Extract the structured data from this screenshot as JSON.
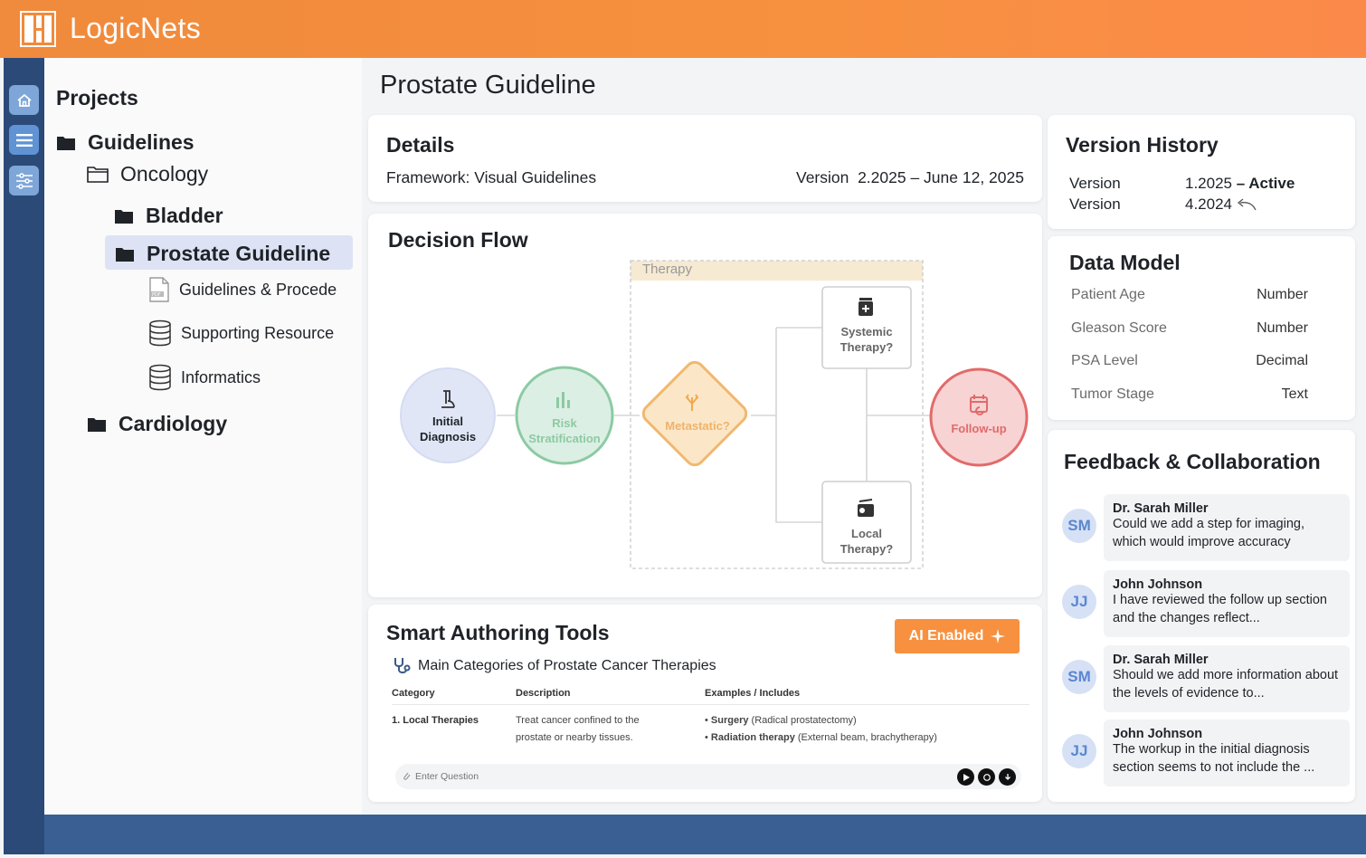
{
  "app": {
    "name": "LogicNets"
  },
  "rail": {
    "icons": [
      "home-icon",
      "menu-icon",
      "sliders-icon"
    ]
  },
  "sidebar": {
    "heading": "Projects",
    "guidelines": "Guidelines",
    "oncology": "Oncology",
    "bladder": "Bladder",
    "prostate": "Prostate Guideline",
    "children": [
      "Guidelines & Procede",
      "Supporting Resource",
      "Informatics"
    ],
    "cardiology": "Cardiology"
  },
  "page": {
    "title": "Prostate Guideline"
  },
  "details": {
    "title": "Details",
    "framework": "Framework: Visual Guidelines",
    "version": "Version  2.2025 – June 12, 2025"
  },
  "version_history": {
    "title": "Version History",
    "rows": [
      {
        "label": "Version",
        "value": "1.2025",
        "status": "– Active"
      },
      {
        "label": "Version",
        "value": "4.2024"
      }
    ]
  },
  "flow": {
    "title": "Decision Flow",
    "therapy_label": "Therapy",
    "initial": [
      "Initial",
      "Diagnosis"
    ],
    "risk": [
      "Risk",
      "Stratification"
    ],
    "metastatic": "Metastatic?",
    "systemic": [
      "Systemic",
      "Therapy?"
    ],
    "local": [
      "Local",
      "Therapy?"
    ],
    "followup": "Follow-up"
  },
  "data_model": {
    "title": "Data Model",
    "rows": [
      {
        "key": "Patient Age",
        "type": "Number"
      },
      {
        "key": "Gleason Score",
        "type": "Number"
      },
      {
        "key": "PSA Level",
        "type": "Decimal"
      },
      {
        "key": "Tumor Stage",
        "type": "Text"
      }
    ]
  },
  "feedback": {
    "title": "Feedback & Collaboration",
    "items": [
      {
        "initials": "SM",
        "name": "Dr. Sarah Miller",
        "text": "Could we add a step for imaging, which would improve accuracy"
      },
      {
        "initials": "JJ",
        "name": "John Johnson",
        "text": "I have reviewed the follow up section and the changes reflect..."
      },
      {
        "initials": "SM",
        "name": "Dr. Sarah Miller",
        "text": "Should we add more information about the levels of evidence to..."
      },
      {
        "initials": "JJ",
        "name": "John Johnson",
        "text": "The workup in the initial diagnosis section seems to not include the ..."
      }
    ]
  },
  "smart": {
    "title": "Smart Authoring Tools",
    "ai_button": "AI Enabled",
    "subtitle": "Main Categories of Prostate Cancer Therapies",
    "headers": [
      "Category",
      "Description",
      "Examples / Includes"
    ],
    "row": {
      "category": "1. Local Therapies",
      "desc1": "Treat cancer confined to the",
      "desc2": "prostate or nearby tissues.",
      "ex1_bold": "Surgery",
      "ex1_rest": " (Radical prostatectomy)",
      "ex2_bold": "Radiation therapy",
      "ex2_rest": " (External beam, brachytherapy)"
    },
    "input_placeholder": "Enter Question"
  },
  "colors": {
    "brand_orange": "#f7913f",
    "rail": "#2b4a78",
    "footer": "#3a5f93",
    "initial_node": "#e1e6f7",
    "risk_node": "#dcefe4",
    "metastatic_node": "#fbe7c8",
    "followup_node": "#f7d3d3"
  }
}
